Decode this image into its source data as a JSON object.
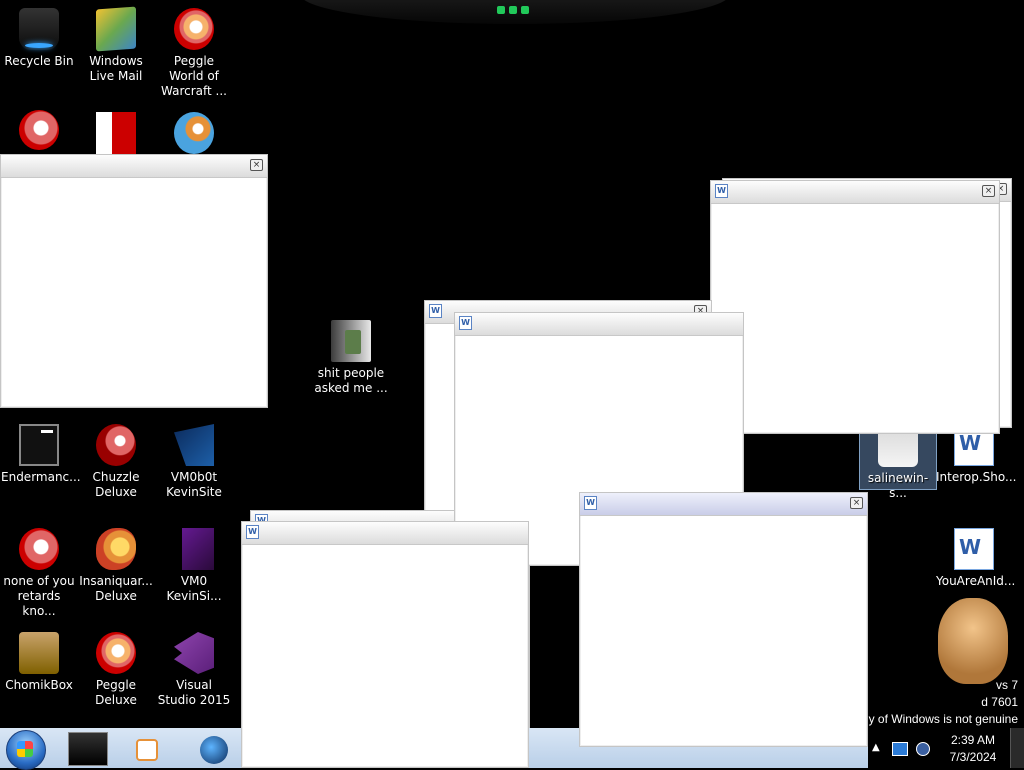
{
  "desktop": {
    "icons": {
      "recycle_bin": "Recycle Bin",
      "windows_live_mail": "Windows Live Mail",
      "peggle_world": "Peggle World of Warcraft ...",
      "endermanch": "Endermanc...",
      "chuzzle": "Chuzzle Deluxe",
      "vm0b0t_kevinsite": "VM0b0t KevinSite",
      "none_of_you": "none of you retards kno...",
      "insaniquarium": "Insaniquar... Deluxe",
      "vm0_kevinsi": "VM0 KevinSi...",
      "chomikbox": "ChomikBox",
      "peggle_deluxe": "Peggle Deluxe",
      "visual_studio": "Visual Studio 2015",
      "shit_people": "shit people asked me ...",
      "salinewin": "salinewin-s...",
      "interop": "Interop.Sho...",
      "you_are_an_idiot": "YouAreAnId..."
    },
    "watermark": {
      "line1": "vs 7",
      "line2": "d 7601",
      "line3": "y of Windows is not genuine"
    }
  },
  "windows": {
    "close_glyph": "×",
    "word_glyph": "W"
  },
  "taskbar": {
    "time": "2:39 AM",
    "date": "7/3/2024",
    "tray_arrow": "▲"
  }
}
